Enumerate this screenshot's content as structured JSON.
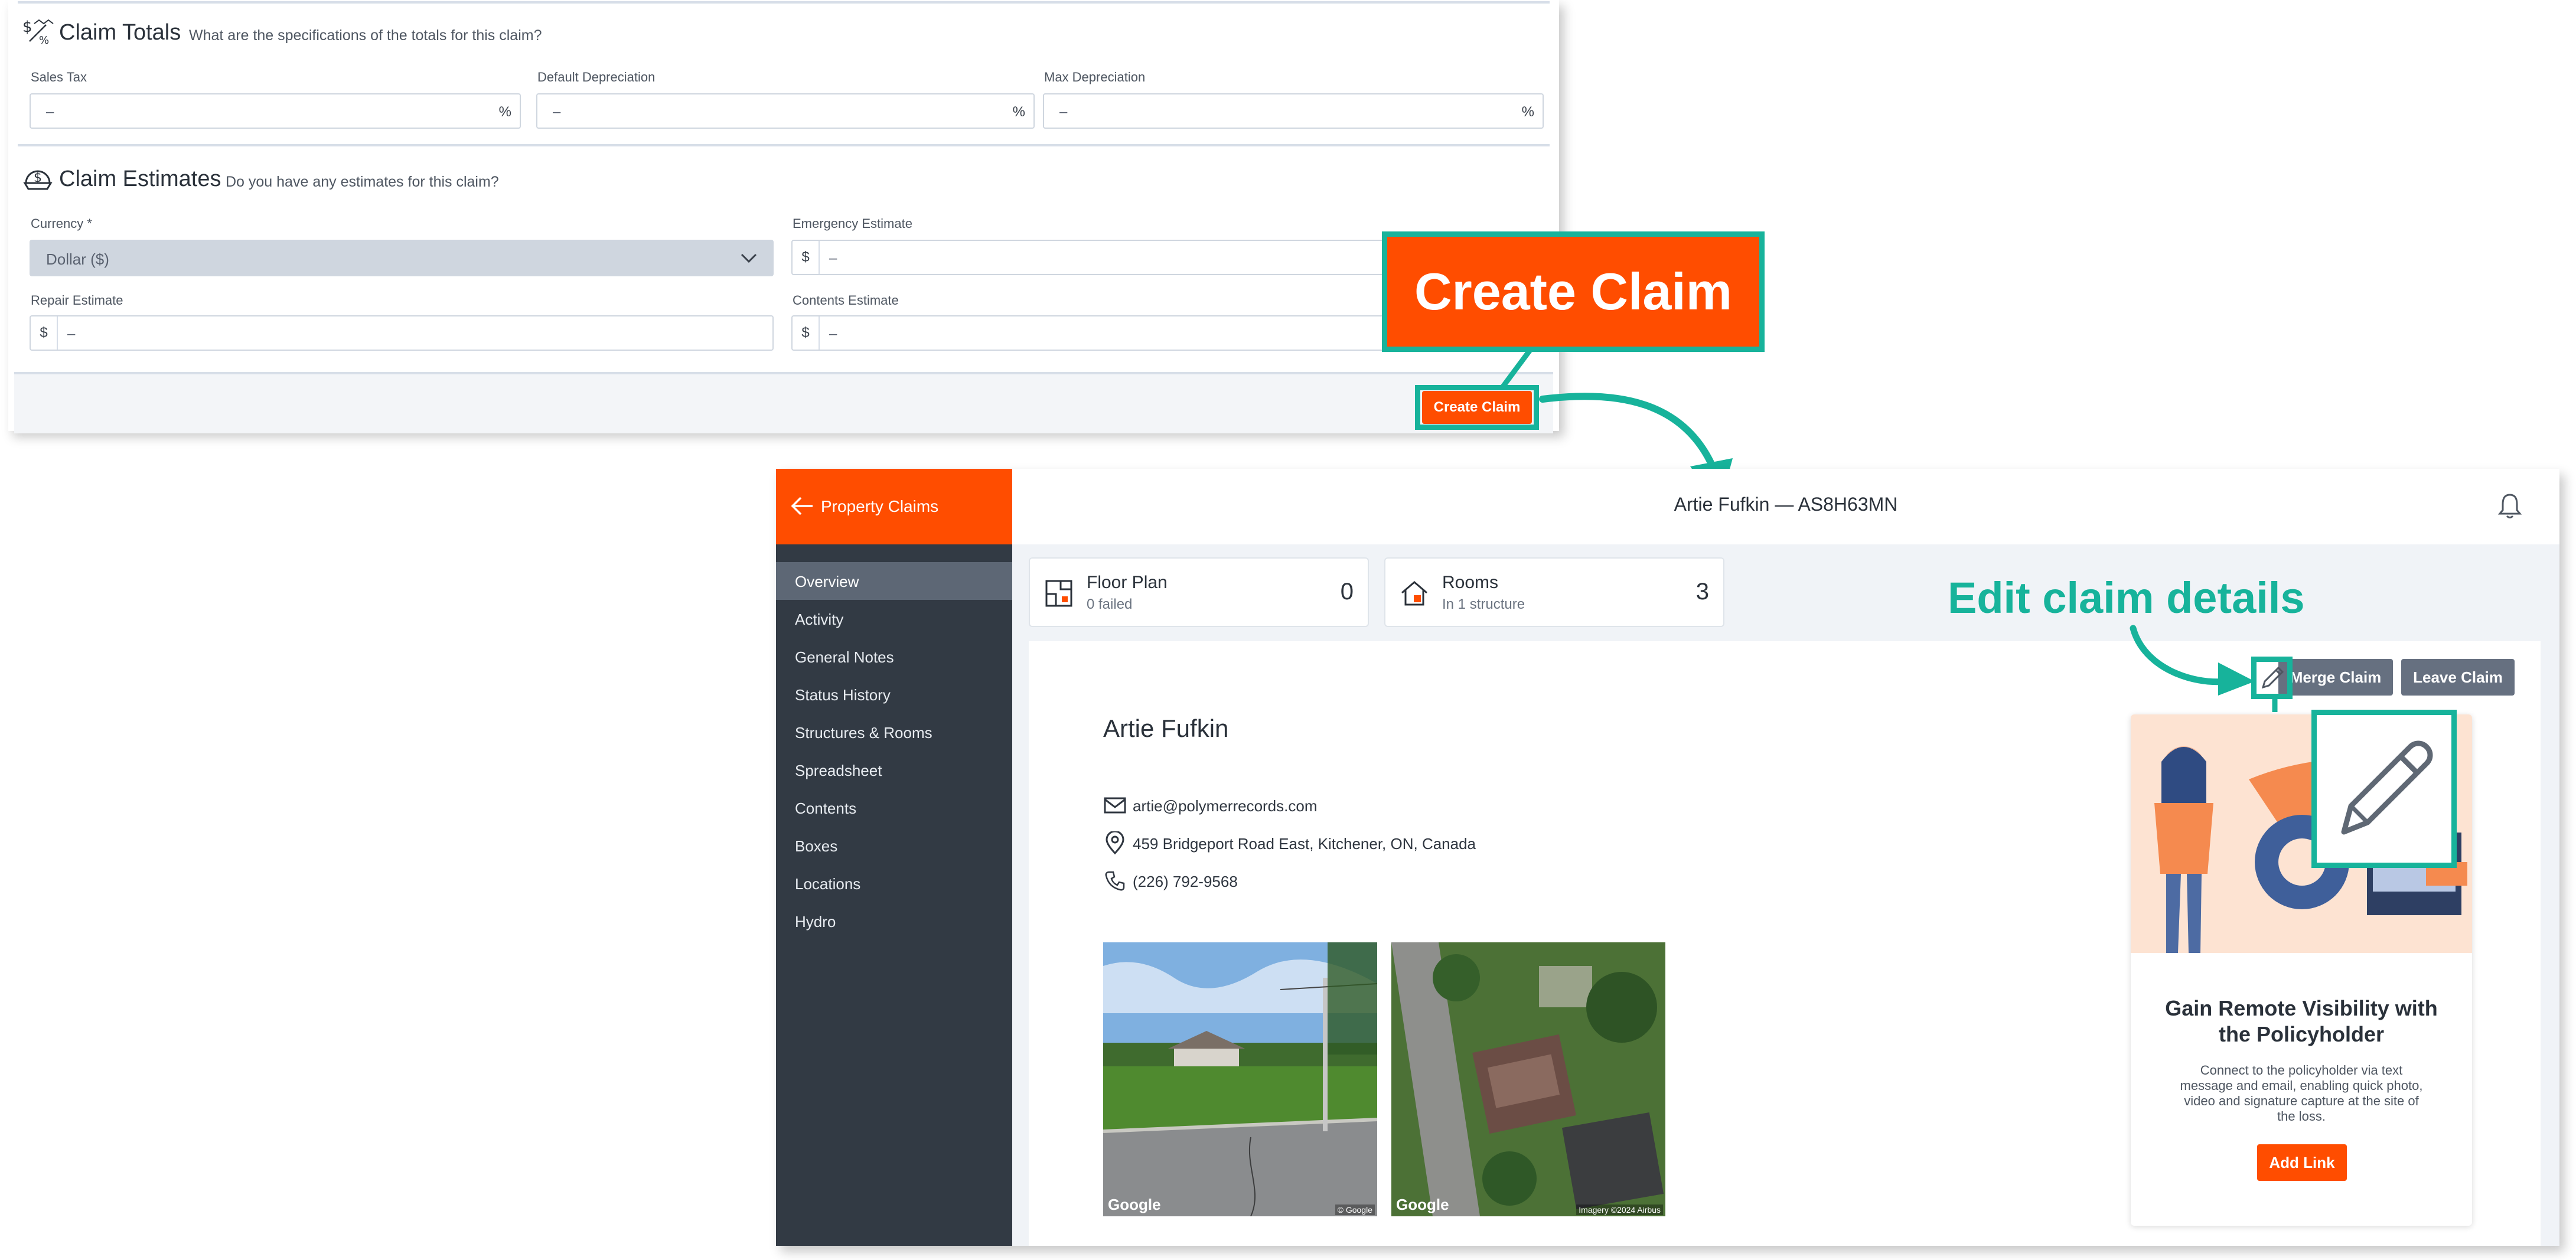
{
  "claim_totals": {
    "title": "Claim Totals",
    "subtitle": "What are the specifications of the totals for this claim?",
    "fields": [
      {
        "label": "Sales Tax",
        "value": "–",
        "suffix": "%"
      },
      {
        "label": "Default Depreciation",
        "value": "–",
        "suffix": "%"
      },
      {
        "label": "Max Depreciation",
        "value": "–",
        "suffix": "%"
      }
    ]
  },
  "claim_estimates": {
    "title": "Claim Estimates",
    "subtitle": "Do you have any estimates for this claim?",
    "currency_label": "Currency *",
    "currency_value": "Dollar ($)",
    "emergency_label": "Emergency Estimate",
    "emergency_value": "–",
    "repair_label": "Repair Estimate",
    "repair_value": "–",
    "contents_label": "Contents Estimate",
    "contents_value": "–",
    "currency_symbol": "$"
  },
  "form_footer": {
    "create_label": "Create Claim"
  },
  "callouts": {
    "create_claim": "Create Claim",
    "edit_claim": "Edit claim details"
  },
  "app": {
    "back_label": "Property Claims",
    "header_title": "Artie Fufkin — AS8H63MN",
    "nav": [
      {
        "label": "Overview",
        "active": true
      },
      {
        "label": "Activity"
      },
      {
        "label": "General Notes"
      },
      {
        "label": "Status History"
      },
      {
        "label": "Structures & Rooms"
      },
      {
        "label": "Spreadsheet"
      },
      {
        "label": "Contents"
      },
      {
        "label": "Boxes"
      },
      {
        "label": "Locations"
      },
      {
        "label": "Hydro"
      }
    ],
    "stats": {
      "floor_plan": {
        "title": "Floor Plan",
        "sub": "0 failed",
        "count": "0"
      },
      "rooms": {
        "title": "Rooms",
        "sub": "In 1 structure",
        "count": "3"
      }
    },
    "actions": {
      "merge": "Merge Claim",
      "leave": "Leave Claim"
    },
    "policyholder": {
      "name": "Artie Fufkin",
      "email": "artie@polymerrecords.com",
      "address": "459 Bridgeport Road East, Kitchener, ON, Canada",
      "phone": "(226) 792-9568"
    },
    "images": {
      "street_brand": "Google",
      "street_credit": "© Google",
      "aerial_brand": "Google",
      "aerial_credit": "Imagery ©2024 Airbus"
    },
    "promo": {
      "title": "Gain Remote Visibility with the Policyholder",
      "body": "Connect to the policyholder via text message and email, enabling quick photo, video and signature capture at the site of the loss.",
      "button": "Add Link"
    }
  },
  "colors": {
    "accent": "#ff4d00",
    "callout": "#17b39b",
    "sidebar": "#323a44"
  }
}
